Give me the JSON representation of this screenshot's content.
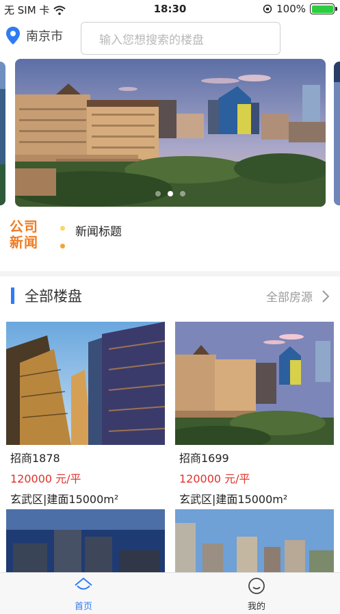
{
  "status": {
    "carrier": "无 SIM 卡",
    "time": "18:30",
    "battery": "100%"
  },
  "header": {
    "city": "南京市",
    "search_placeholder": "输入您想搜索的楼盘"
  },
  "carousel": {
    "slide_count": 3,
    "active_index": 1
  },
  "news": {
    "logo_line1": "公司",
    "logo_line2": "新闻",
    "title": "新闻标题"
  },
  "section": {
    "title": "全部楼盘",
    "more": "全部房源"
  },
  "listings": [
    {
      "name": "招商1878",
      "price": "120000 元/平",
      "info": "玄武区|建面15000m²"
    },
    {
      "name": "招商1699",
      "price": "120000 元/平",
      "info": "玄武区|建面15000m²"
    }
  ],
  "tabbar": {
    "home": "首页",
    "mine": "我的"
  },
  "colors": {
    "accent": "#2f7bf5",
    "price": "#e0312b",
    "news_logo": "#f07b21"
  }
}
